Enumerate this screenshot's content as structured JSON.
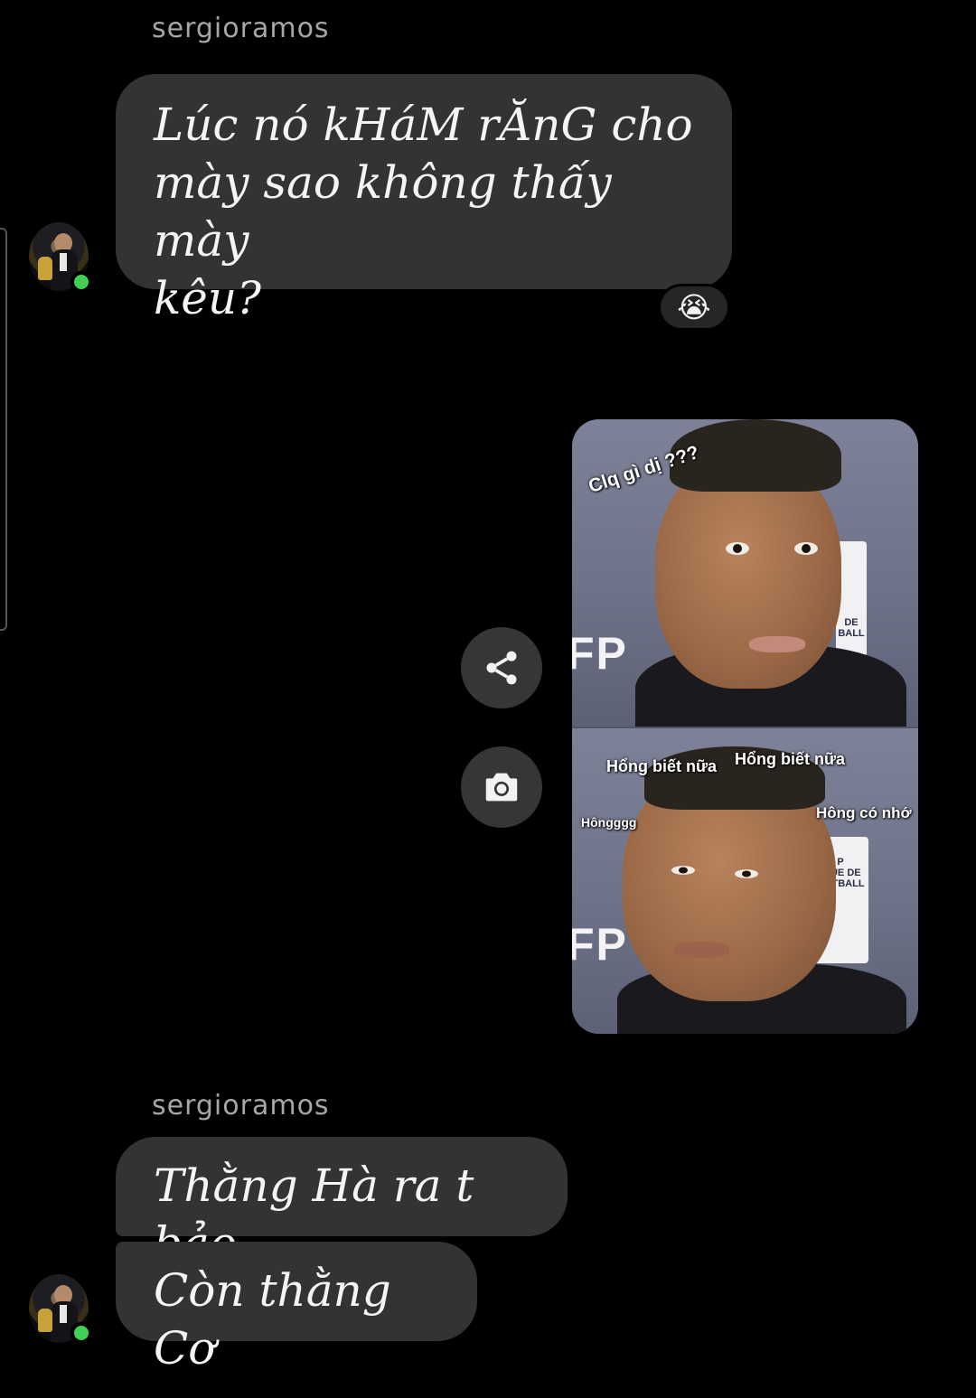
{
  "colors": {
    "background": "#000000",
    "bubble": "#333333",
    "sender_name": "#a7a7a7",
    "online": "#3fd154"
  },
  "thread": {
    "group_one": {
      "sender": "sergioramos",
      "message": "Lúc nó kHáM rĂnG cho\nmày sao không thấy mày\nkêu?",
      "reaction": "😭"
    },
    "media_message": {
      "captions": {
        "top": "Clq gì dị ???",
        "bottom_left": "Hổng biết nữa",
        "bottom_right": "Hổng biết nữa",
        "bottom_side_left": "Hôngggg",
        "bottom_side_right": "Hông có nhớ"
      },
      "backdrop_logo": "FP",
      "backdrop_board_top": "DE\nBALL",
      "backdrop_board_bottom": "P\nIGUE DE\nOOTBALL",
      "actions": {
        "share_icon": "share-icon",
        "camera_icon": "camera-icon"
      }
    },
    "group_two": {
      "sender": "sergioramos",
      "messages": [
        "Thằng Hà ra t bảo",
        "Còn thằng Cơ"
      ]
    }
  }
}
